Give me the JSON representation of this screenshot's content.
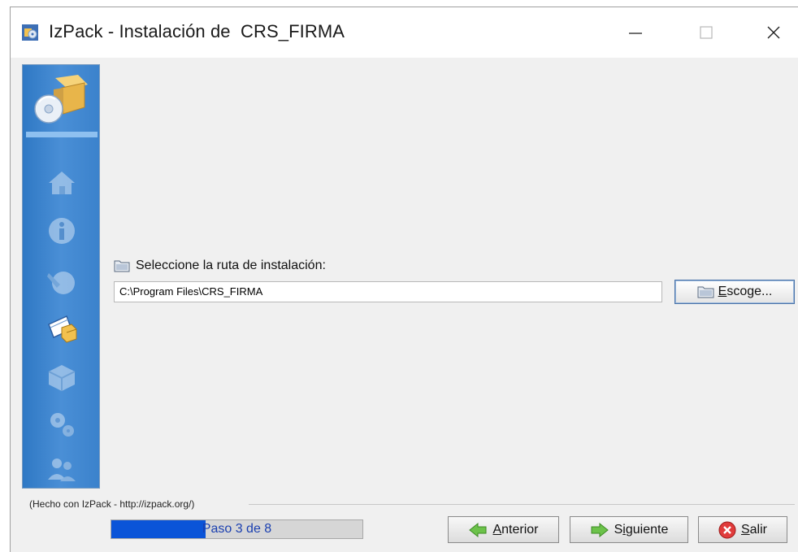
{
  "window": {
    "title": "IzPack - Instalación de  CRS_FIRMA",
    "icons": [
      "izpack-icon",
      "minimize-icon",
      "maximize-icon",
      "close-icon"
    ]
  },
  "sidebar": {
    "main_icon": "installer-box-cd-icon",
    "steps": [
      {
        "icon": "home-icon",
        "state": "done"
      },
      {
        "icon": "info-icon",
        "state": "done"
      },
      {
        "icon": "license-icon",
        "state": "done"
      },
      {
        "icon": "target-folder-icon",
        "state": "active"
      },
      {
        "icon": "packs-icon",
        "state": "pending"
      },
      {
        "icon": "gears-icon",
        "state": "pending"
      },
      {
        "icon": "users-icon",
        "state": "pending"
      }
    ]
  },
  "target": {
    "label": "Seleccione la ruta de instalación:",
    "path_value": "C:\\Program Files\\CRS_FIRMA",
    "browse_label": "scoge...",
    "browse_mnemonic": "E"
  },
  "footer": {
    "credits": "(Hecho con IzPack - http://izpack.org/)",
    "progress_text": "Paso 3 de 8",
    "progress_fraction": 0.375,
    "buttons": {
      "back": {
        "mnemonic": "A",
        "rest": "nterior"
      },
      "next": {
        "pre": "S",
        "mnemonic": "i",
        "rest": "guiente"
      },
      "quit": {
        "mnemonic": "S",
        "rest": "alir"
      }
    }
  },
  "colors": {
    "sidebar": "#3b82cc",
    "progress_fill": "#0a54d8",
    "window_bg": "#f0f0f0"
  }
}
